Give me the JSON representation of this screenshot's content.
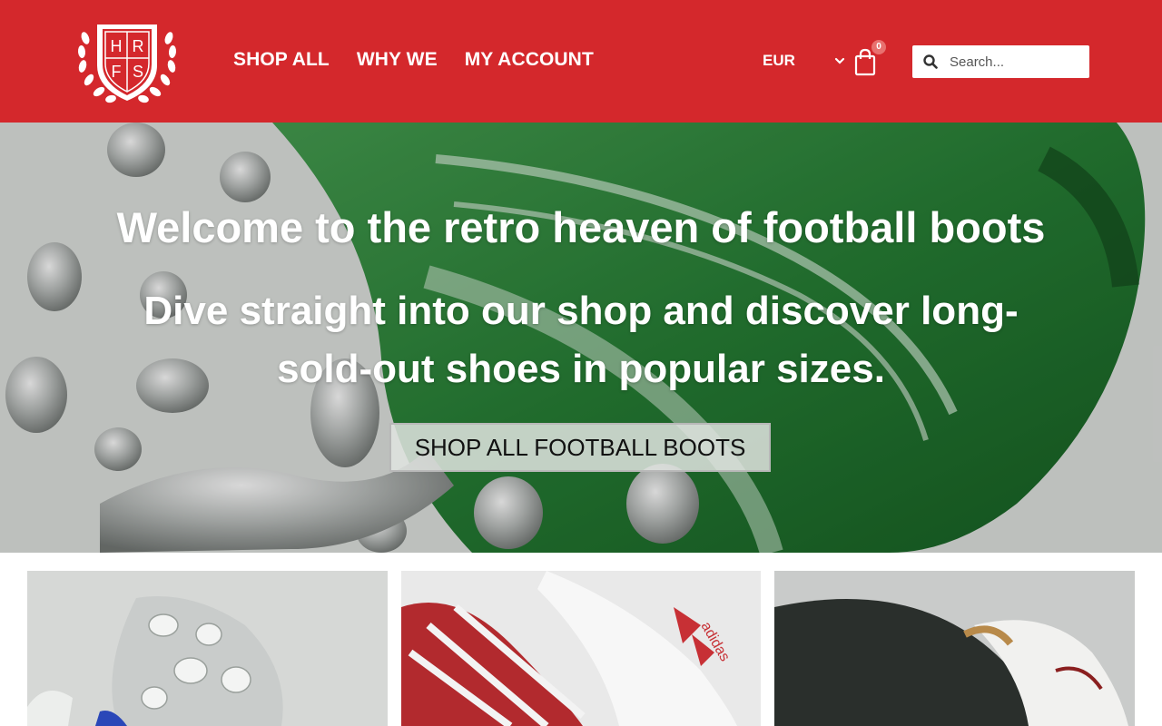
{
  "header": {
    "logo_letters": [
      "H",
      "R",
      "F",
      "S"
    ],
    "nav": [
      {
        "label": "SHOP ALL"
      },
      {
        "label": "WHY WE"
      },
      {
        "label": "MY ACCOUNT"
      }
    ],
    "currency": "EUR",
    "cart_count": "0",
    "search_placeholder": "Search...",
    "brand_color": "#d4282c"
  },
  "hero": {
    "title": "Welcome to the retro heaven of football boots",
    "subtitle": "Dive straight into our shop and discover long-sold-out shoes in popular sizes.",
    "cta_label": "SHOP ALL FOOTBALL BOOTS"
  },
  "tiles": [
    {
      "image": "silver-football-boot-soleplate"
    },
    {
      "image": "red-white-football-boot-tongue"
    },
    {
      "image": "black-leather-football-boot-heel"
    }
  ]
}
